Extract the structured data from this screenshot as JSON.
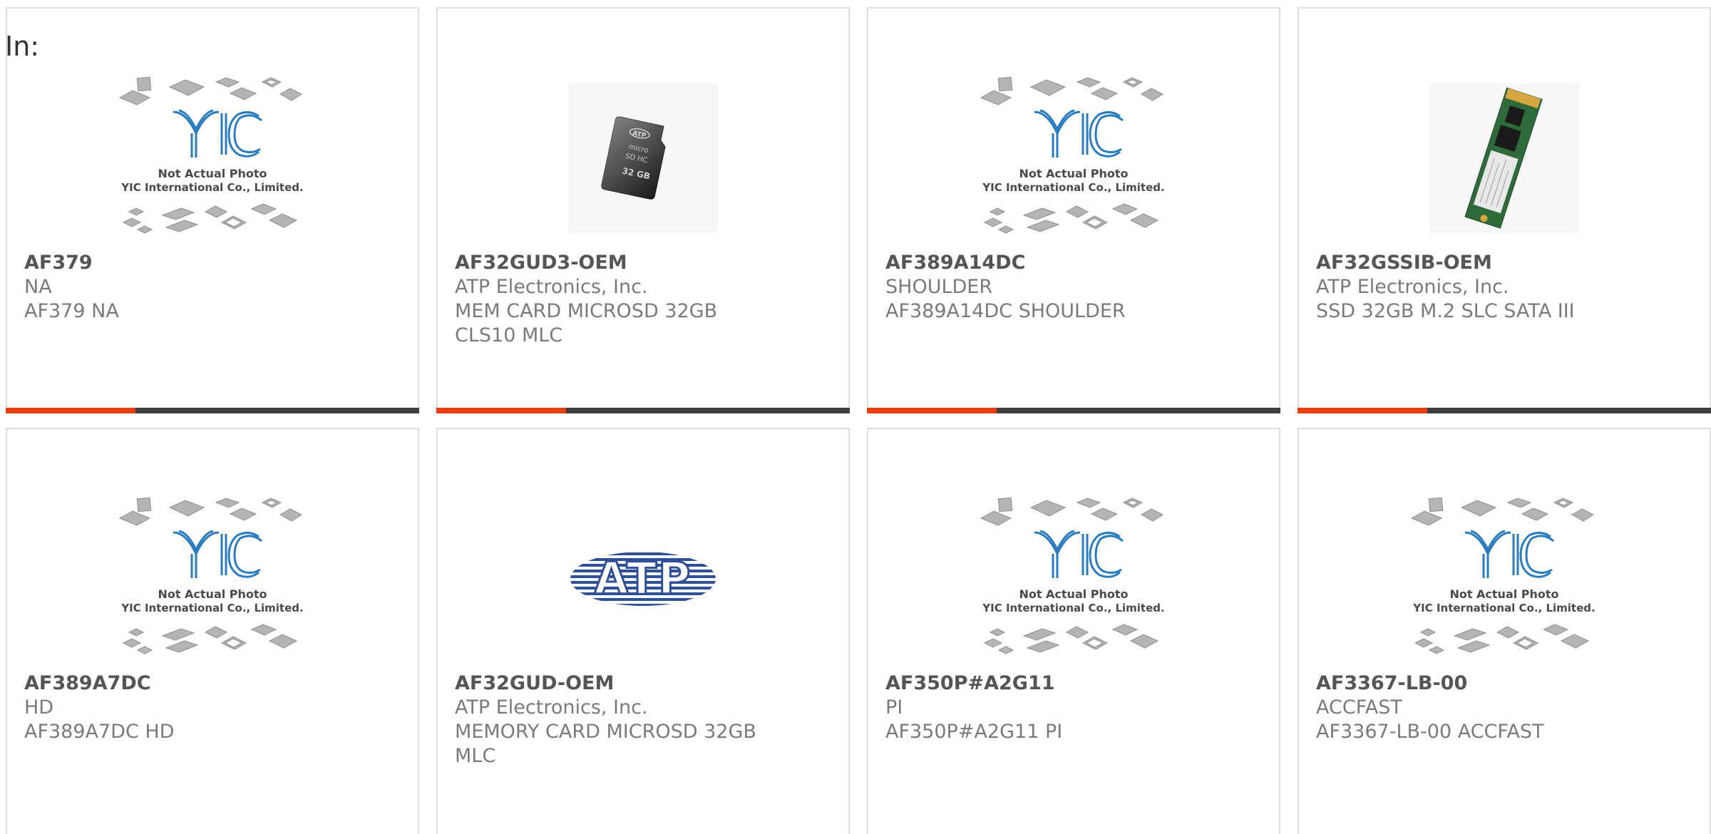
{
  "header": {
    "in_label": "In:"
  },
  "placeholder": {
    "logo_text": "YIC",
    "line1": "Not Actual Photo",
    "line2": "YIC International Co., Limited."
  },
  "atp_logo_text": "ATP",
  "microsd_text": {
    "brand": "ATP",
    "line1": "micro",
    "line2": "SD HC",
    "size": "32 GB"
  },
  "colors": {
    "accent": "#e5400f",
    "bar": "#3f3f3f",
    "border": "#dedede",
    "text": "#7a7a7a"
  },
  "products": [
    {
      "part": "AF379",
      "manufacturer": "NA",
      "desc1": "AF379 NA",
      "desc2": "",
      "image": "yic-placeholder"
    },
    {
      "part": "AF32GUD3-OEM",
      "manufacturer": "ATP Electronics, Inc.",
      "desc1": "MEM CARD MICROSD 32GB",
      "desc2": "CLS10 MLC",
      "image": "microsd-card"
    },
    {
      "part": "AF389A14DC",
      "manufacturer": "SHOULDER",
      "desc1": "AF389A14DC SHOULDER",
      "desc2": "",
      "image": "yic-placeholder"
    },
    {
      "part": "AF32GSSIB-OEM",
      "manufacturer": "ATP Electronics, Inc.",
      "desc1": "SSD 32GB M.2 SLC SATA III",
      "desc2": "",
      "image": "m2-ssd"
    },
    {
      "part": "AF389A7DC",
      "manufacturer": "HD",
      "desc1": "AF389A7DC HD",
      "desc2": "",
      "image": "yic-placeholder"
    },
    {
      "part": "AF32GUD-OEM",
      "manufacturer": "ATP Electronics, Inc.",
      "desc1": "MEMORY CARD MICROSD 32GB",
      "desc2": "MLC",
      "image": "atp-logo"
    },
    {
      "part": "AF350P#A2G11",
      "manufacturer": "PI",
      "desc1": "AF350P#A2G11 PI",
      "desc2": "",
      "image": "yic-placeholder"
    },
    {
      "part": "AF3367-LB-00",
      "manufacturer": "ACCFAST",
      "desc1": "AF3367-LB-00 ACCFAST",
      "desc2": "",
      "image": "yic-placeholder"
    }
  ]
}
